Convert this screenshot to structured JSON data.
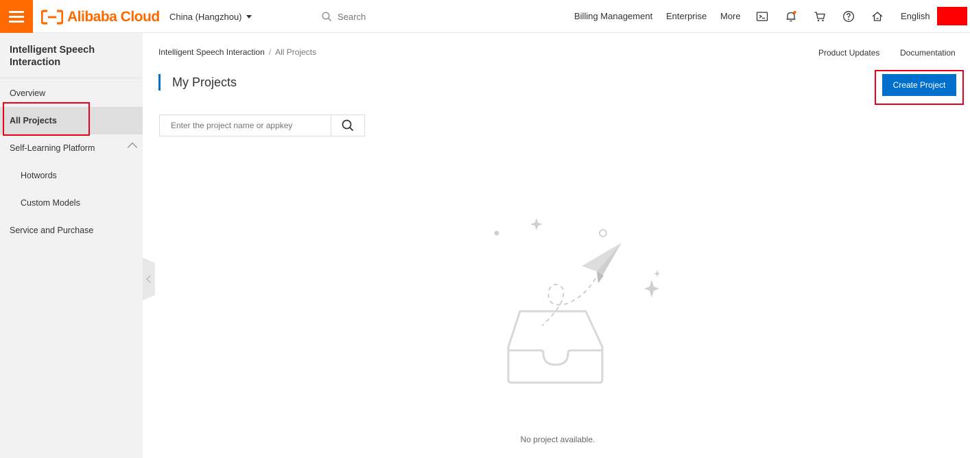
{
  "topbar": {
    "brand": "Alibaba Cloud",
    "region": "China (Hangzhou)",
    "search_placeholder": "Search",
    "links": {
      "billing": "Billing Management",
      "enterprise": "Enterprise",
      "more": "More",
      "language": "English"
    },
    "icons": [
      "terminal-icon",
      "bell-icon",
      "cart-icon",
      "help-icon",
      "home-icon"
    ]
  },
  "sidebar": {
    "title": "Intelligent Speech Interaction",
    "items": [
      {
        "label": "Overview"
      },
      {
        "label": "All Projects"
      },
      {
        "label": "Self-Learning Platform"
      },
      {
        "label": "Hotwords"
      },
      {
        "label": "Custom Models"
      },
      {
        "label": "Service and Purchase"
      }
    ]
  },
  "breadcrumb": {
    "root": "Intelligent Speech Interaction",
    "separator": "/",
    "current": "All Projects"
  },
  "header_links": {
    "product_updates": "Product Updates",
    "documentation": "Documentation"
  },
  "main": {
    "title": "My Projects",
    "create_button": "Create Project",
    "search_placeholder": "Enter the project name or appkey",
    "empty_message": "No project available."
  },
  "colors": {
    "brand_orange": "#ff6a00",
    "primary_blue": "#0070cc",
    "annotation_red": "#e8001c"
  }
}
